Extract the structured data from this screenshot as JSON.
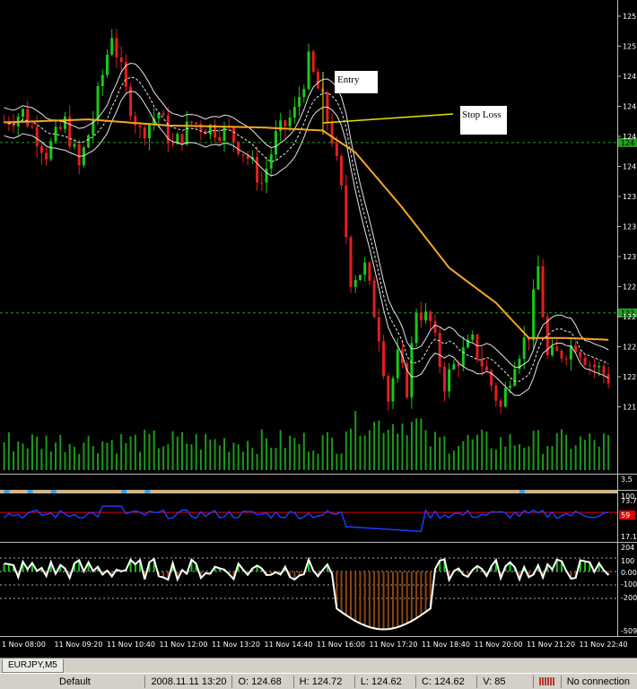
{
  "symbol_tab": "EURJPY,M5",
  "status": {
    "profile": "Default",
    "datetime": "2008.11.11 13:20",
    "open": "O: 124.68",
    "high": "H: 124.72",
    "low": "L: 124.62",
    "close": "C: 124.62",
    "volume": "V: 85",
    "connection": "No connection"
  },
  "colors": {
    "background": "#000000",
    "bull_candle": "#19c819",
    "bear_candle": "#e61e1e",
    "volume": "#1a9a1a",
    "ma_orange": "#f5a623",
    "band": "#e6e6e6",
    "stop_line": "#e8e200",
    "grid_dashed": "#1ea01e",
    "rsi_line": "#1e3cff",
    "rsi_level": "#e00000",
    "cci_line": "#ffffff",
    "cci_hist": "#8b4513"
  },
  "annotations": {
    "entry": "Entry",
    "stop_loss": "Stop Loss"
  },
  "price_axis": {
    "ticks": [
      "125",
      "125",
      "124",
      "124",
      "124",
      "124",
      "123",
      "123",
      "123",
      "122",
      "122",
      "122",
      "122",
      "121"
    ],
    "highlight_labels": [
      "124",
      "122"
    ]
  },
  "time_axis": {
    "labels": [
      "1 Nov 08:00",
      "11 Nov 09:20",
      "11 Nov 10:40",
      "11 Nov 12:00",
      "11 Nov 13:20",
      "11 Nov 14:40",
      "11 Nov 16:00",
      "11 Nov 17:20",
      "11 Nov 18:40",
      "11 Nov 20:00",
      "11 Nov 21:20",
      "11 Nov 22:40"
    ]
  },
  "rsi_panel": {
    "top_label": "100",
    "levels": [
      "73.7",
      "17.1"
    ],
    "marker_label": "59"
  },
  "cci_panel": {
    "top_label": "204",
    "levels": [
      "100",
      "0.00",
      "-100",
      "-200",
      "-509"
    ]
  },
  "chart_data": {
    "type": "candlestick",
    "timeframe": "M5",
    "symbol": "EURJPY",
    "ylim": [
      121.0,
      125.6
    ],
    "price_path": [
      [
        0,
        124.46
      ],
      [
        4,
        124.55
      ],
      [
        9,
        124.15
      ],
      [
        13,
        124.45
      ],
      [
        16,
        124.0
      ],
      [
        19,
        124.5
      ],
      [
        23,
        125.35
      ],
      [
        26,
        124.75
      ],
      [
        29,
        124.35
      ],
      [
        33,
        124.55
      ],
      [
        36,
        124.2
      ],
      [
        40,
        124.45
      ],
      [
        44,
        124.4
      ],
      [
        48,
        124.35
      ],
      [
        52,
        124.1
      ],
      [
        55,
        123.85
      ],
      [
        58,
        124.3
      ],
      [
        62,
        124.55
      ],
      [
        65,
        125.05
      ],
      [
        68,
        124.65
      ],
      [
        70,
        124.3
      ],
      [
        72,
        123.75
      ],
      [
        74,
        122.9
      ],
      [
        77,
        123.0
      ],
      [
        80,
        122.35
      ],
      [
        82,
        121.7
      ],
      [
        84,
        122.1
      ],
      [
        86,
        121.8
      ],
      [
        88,
        122.6
      ],
      [
        91,
        122.45
      ],
      [
        94,
        121.85
      ],
      [
        97,
        122.1
      ],
      [
        100,
        122.25
      ],
      [
        103,
        121.95
      ],
      [
        106,
        121.6
      ],
      [
        109,
        122.1
      ],
      [
        112,
        122.35
      ],
      [
        114,
        123.0
      ],
      [
        116,
        122.1
      ],
      [
        119,
        122.15
      ],
      [
        122,
        122.25
      ],
      [
        125,
        122.05
      ],
      [
        128,
        121.95
      ],
      [
        130,
        121.85
      ]
    ],
    "moving_average_path": [
      [
        0,
        124.45
      ],
      [
        18,
        124.48
      ],
      [
        35,
        124.42
      ],
      [
        55,
        124.4
      ],
      [
        68,
        124.37
      ],
      [
        75,
        124.15
      ],
      [
        85,
        123.6
      ],
      [
        95,
        123.0
      ],
      [
        105,
        122.65
      ],
      [
        112,
        122.3
      ],
      [
        120,
        122.3
      ],
      [
        130,
        122.28
      ]
    ],
    "annotation_lines": {
      "entry_price": 124.52,
      "stop_loss_price": 124.55
    },
    "horizontal_levels": [
      124.25,
      122.55
    ],
    "rsi_levels": [
      73.7,
      17.1
    ],
    "cci_levels": [
      100,
      0,
      -100,
      -200
    ]
  }
}
